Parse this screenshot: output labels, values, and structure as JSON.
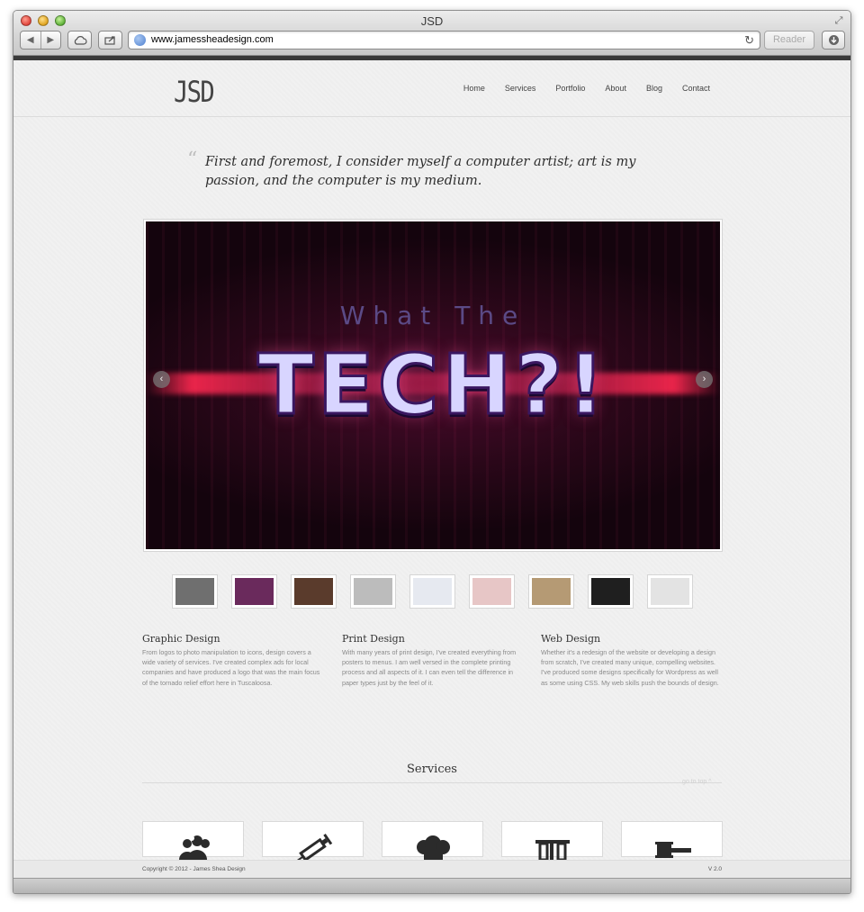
{
  "browser": {
    "window_title": "JSD",
    "url": "www.jamessheadesign.com",
    "reader_label": "Reader",
    "icons": [
      "back-icon",
      "forward-icon",
      "cloud-icon",
      "share-icon",
      "globe-icon",
      "reload-icon",
      "download-icon",
      "fullscreen-icon"
    ]
  },
  "site": {
    "logo": "JSD",
    "nav": [
      "Home",
      "Services",
      "Portfolio",
      "About",
      "Blog",
      "Contact"
    ],
    "quote": "First and foremost, I consider myself a computer artist; art is my passion, and the computer is my medium.",
    "quote_mark": "“"
  },
  "slider": {
    "subtitle": "What The",
    "title": "TECH?!",
    "prev_label": "‹",
    "next_label": "›",
    "thumbnails": [
      {
        "name": "thumb-spirit",
        "color": "#6f6f6f"
      },
      {
        "name": "thumb-tech",
        "color": "#6a2a5c"
      },
      {
        "name": "thumb-band",
        "color": "#5a3b2c"
      },
      {
        "name": "thumb-oit",
        "color": "#bcbcbc"
      },
      {
        "name": "thumb-product",
        "color": "#e6e9f0"
      },
      {
        "name": "thumb-web-red",
        "color": "#e7c6c6"
      },
      {
        "name": "thumb-photo",
        "color": "#b59a74"
      },
      {
        "name": "thumb-faces",
        "color": "#1f1f1f"
      },
      {
        "name": "thumb-site",
        "color": "#e3e3e3"
      }
    ]
  },
  "columns": [
    {
      "title": "Graphic Design",
      "text": "From logos to photo manipulation to icons, design covers a wide variety of services. I've created complex ads for local companies and have produced a logo that was the main focus of the tornado relief effort here in Tuscaloosa."
    },
    {
      "title": "Print Design",
      "text": "With many years of print design, I've created everything from posters to menus. I am well versed in the complete printing process and all aspects of it. I can even tell the difference in paper types just by the feel of it."
    },
    {
      "title": "Web Design",
      "text": "Whether it's a redesign of the website or developing a design from scratch, I've created many unique, compelling websites. I've produced some designs specifically for Wordpress as well as some using CSS. My web skills push the bounds of design."
    }
  ],
  "services": {
    "title": "Services",
    "go_to_top": "go to top ^",
    "boxes": [
      "people-icon",
      "syringe-icon",
      "chef-hat-icon",
      "test-tubes-icon",
      "gavel-icon"
    ]
  },
  "footer": {
    "copyright": "Copyright © 2012 - James Shea Design",
    "version": "V 2.0"
  }
}
